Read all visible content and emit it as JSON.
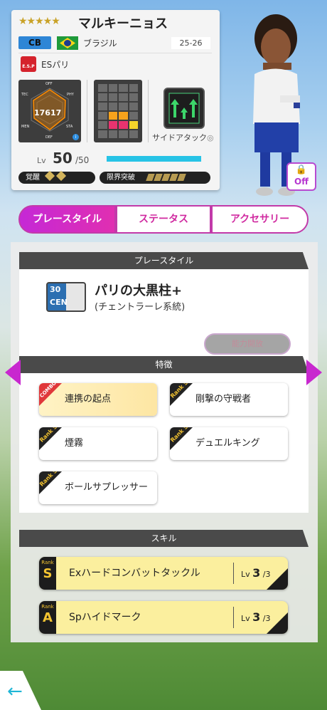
{
  "player": {
    "stars": "★★★★★",
    "name": "マルキーニョス",
    "position": "CB",
    "nation": "ブラジル",
    "season": "25-26",
    "club": "ESパリ",
    "club_badge": "E.S.P",
    "rating": "17617",
    "radar_labels": {
      "off": "OFF",
      "tec": "TEC",
      "phy": "PHY",
      "men": "MEN",
      "sta": "STA",
      "def": "DEF"
    },
    "skill_caption": "サイドアタック",
    "level_label": "Lv",
    "level": "50",
    "level_max": "/50",
    "awaken_label": "覚醒",
    "limit_label": "限界突破",
    "off_label": "Off"
  },
  "tabs": [
    {
      "label": "プレースタイル",
      "active": true
    },
    {
      "label": "ステータス",
      "active": false
    },
    {
      "label": "アクセサリー",
      "active": false
    }
  ],
  "playstyle": {
    "header": "プレースタイル",
    "badge_num": "30",
    "badge_pos": "CEN",
    "name": "パリの大黒柱+",
    "sub": "(チェントラーレ系統)",
    "button": "能力開放"
  },
  "traits": {
    "header": "特徴",
    "items": [
      {
        "label": "連携の起点",
        "rank": "COMBO"
      },
      {
        "label": "剛撃の守戦者",
        "rank": "Rank S"
      },
      {
        "label": "煙霧",
        "rank": "Rank S"
      },
      {
        "label": "デュエルキング",
        "rank": "Rank S"
      },
      {
        "label": "ボールサプレッサー",
        "rank": "Rank S"
      }
    ]
  },
  "skills": {
    "header": "スキル",
    "items": [
      {
        "rank_word": "Rank",
        "rank": "S",
        "name": "Exハードコンバットタックル",
        "lv_label": "Lv",
        "lv": "3",
        "lv_max": "/3"
      },
      {
        "rank_word": "Rank",
        "rank": "A",
        "name": "Spハイドマーク",
        "lv_label": "Lv",
        "lv": "3",
        "lv_max": "/3"
      }
    ]
  },
  "nav": {
    "back_icon": "←"
  },
  "colors": {
    "accent": "#c828cf",
    "level_bar": "#27c3e6",
    "position_badge": "#2e86d6"
  }
}
